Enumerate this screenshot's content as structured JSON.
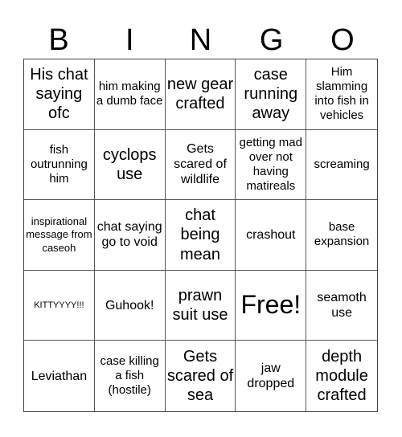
{
  "header": {
    "letters": [
      "B",
      "I",
      "N",
      "G",
      "O"
    ]
  },
  "cells": [
    [
      "His chat saying ofc",
      "him making a dumb face",
      "new gear crafted",
      "case running away",
      "Him slamming into fish in vehicles"
    ],
    [
      "fish outrunning him",
      "cyclops use",
      "Gets scared of wildlife",
      "getting mad over not having matireals",
      "screaming"
    ],
    [
      "inspirational message from caseoh",
      "chat saying go to void",
      "chat being mean",
      "crashout",
      "base expansion"
    ],
    [
      "KITTYYYY!!!",
      "Guhook!",
      "prawn suit use",
      "Free!",
      "seamoth use"
    ],
    [
      "Leviathan",
      "case killing a fish (hostile)",
      "Gets scared of sea",
      "jaw dropped",
      "depth module crafted"
    ]
  ],
  "free_space": {
    "row": 3,
    "col": 3,
    "label": "Free!"
  }
}
